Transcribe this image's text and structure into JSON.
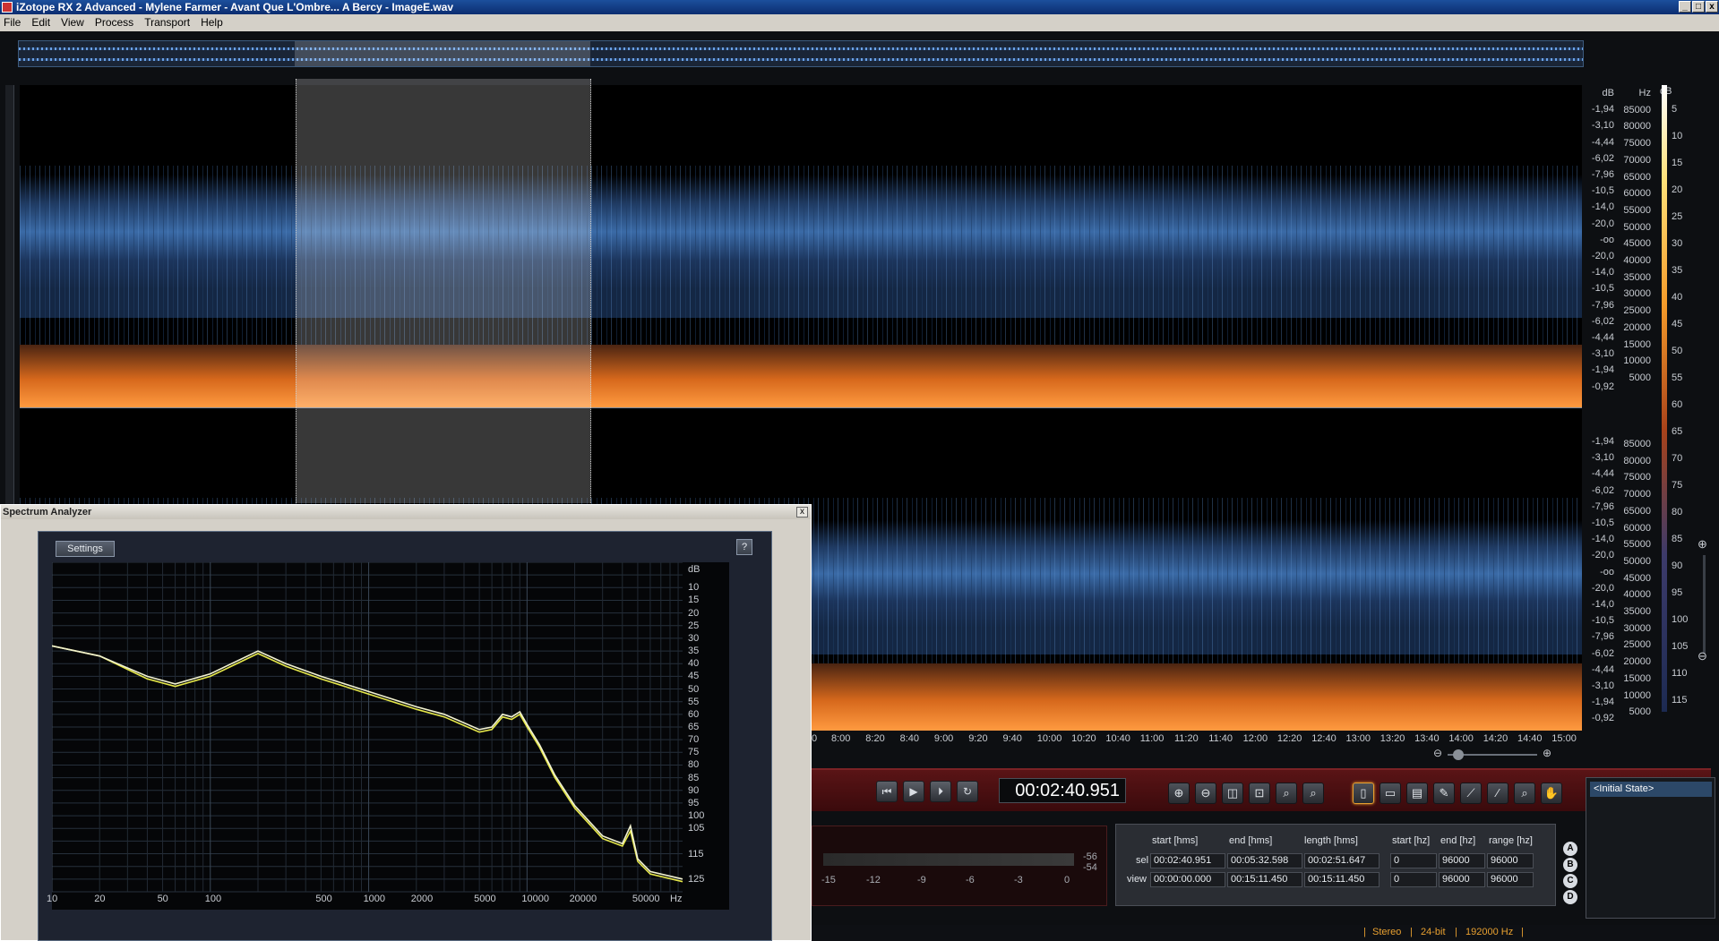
{
  "window": {
    "title": "iZotope RX 2 Advanced - Mylene Farmer - Avant Que L'Ombre... A Bercy - ImageE.wav"
  },
  "menu": [
    "File",
    "Edit",
    "View",
    "Process",
    "Transport",
    "Help"
  ],
  "spectrogram": {
    "db_scale_top": [
      "dB",
      "-1,94",
      "-3,10",
      "-4,44",
      "-6,02",
      "-7,96",
      "-10,5",
      "-14,0",
      "-20,0",
      "-oo",
      "-20,0",
      "-14,0",
      "-10,5",
      "-7,96",
      "-6,02",
      "-4,44",
      "-3,10",
      "-1,94",
      "-0,92"
    ],
    "db_scale_bottom": [
      "-1,94",
      "-3,10",
      "-4,44",
      "-6,02",
      "-7,96",
      "-10,5",
      "-14,0",
      "-20,0",
      "-oo",
      "-20,0",
      "-14,0",
      "-10,5",
      "-7,96",
      "-6,02",
      "-4,44",
      "-3,10",
      "-1,94",
      "-0,92"
    ],
    "hz_scale_top": [
      "Hz",
      "85000",
      "80000",
      "75000",
      "70000",
      "65000",
      "60000",
      "55000",
      "50000",
      "45000",
      "40000",
      "35000",
      "30000",
      "25000",
      "20000",
      "15000",
      "10000",
      "5000"
    ],
    "hz_scale_bottom": [
      "85000",
      "80000",
      "75000",
      "70000",
      "65000",
      "60000",
      "55000",
      "50000",
      "45000",
      "40000",
      "35000",
      "30000",
      "25000",
      "20000",
      "15000",
      "10000",
      "5000"
    ],
    "colorbar_label": "dB",
    "colorbar_ticks": [
      "5",
      "10",
      "15",
      "20",
      "25",
      "30",
      "35",
      "40",
      "45",
      "50",
      "55",
      "60",
      "65",
      "70",
      "75",
      "80",
      "85",
      "90",
      "95",
      "100",
      "105",
      "110",
      "115"
    ],
    "time_axis": [
      "0",
      "8:00",
      "8:20",
      "8:40",
      "9:00",
      "9:20",
      "9:40",
      "10:00",
      "10:20",
      "10:40",
      "11:00",
      "11:20",
      "11:40",
      "12:00",
      "12:20",
      "12:40",
      "13:00",
      "13:20",
      "13:40",
      "14:00",
      "14:20",
      "14:40",
      "15:00"
    ]
  },
  "transport": {
    "timecode": "00:02:40.951",
    "buttons": [
      "skip-back",
      "play",
      "play-selection",
      "loop"
    ],
    "tools": [
      "zoom-in",
      "zoom-out",
      "zoom-selection",
      "zoom-fit",
      "zoom-time",
      "zoom-freq",
      "time-select",
      "rect-select",
      "lasso-select",
      "freq-select",
      "magic-wand",
      "brush",
      "zoom-tool",
      "hand-tool"
    ]
  },
  "meter": {
    "scale": [
      "-15",
      "-12",
      "-9",
      "-6",
      "-3",
      "0"
    ],
    "peaks": [
      "-56",
      "-54"
    ]
  },
  "selection": {
    "headers": [
      "start [hms]",
      "end [hms]",
      "length [hms]",
      "start [hz]",
      "end [hz]",
      "range [hz]"
    ],
    "rows": [
      {
        "label": "sel",
        "values": [
          "00:02:40.951",
          "00:05:32.598",
          "00:02:51.647",
          "0",
          "96000",
          "96000"
        ]
      },
      {
        "label": "view",
        "values": [
          "00:00:00.000",
          "00:15:11.450",
          "00:15:11.450",
          "0",
          "96000",
          "96000"
        ]
      }
    ]
  },
  "abcd": [
    "A",
    "B",
    "C",
    "D"
  ],
  "history": {
    "items": [
      "<Initial State>"
    ]
  },
  "status": {
    "channels": "Stereo",
    "bitdepth": "24-bit",
    "samplerate": "192000 Hz"
  },
  "spectrum_analyzer": {
    "title": "Spectrum Analyzer",
    "settings_label": "Settings",
    "help_label": "?",
    "close_label": "x"
  },
  "chart_data": {
    "type": "line",
    "title": "",
    "xlabel": "Hz",
    "ylabel": "dB",
    "x_scale": "log",
    "xlim": [
      10,
      96000
    ],
    "ylim": [
      130,
      0
    ],
    "x_tick_labels": [
      "10",
      "20",
      "50",
      "100",
      "500",
      "1000",
      "2000",
      "5000",
      "10000",
      "20000",
      "50000",
      "Hz"
    ],
    "y_tick_labels": [
      "dB",
      "10",
      "15",
      "20",
      "25",
      "30",
      "35",
      "40",
      "45",
      "50",
      "55",
      "60",
      "65",
      "70",
      "75",
      "80",
      "85",
      "90",
      "95",
      "100",
      "105",
      "115",
      "125"
    ],
    "series": [
      {
        "color": "#e6e84a",
        "x": [
          10,
          20,
          40,
          60,
          100,
          200,
          300,
          500,
          1000,
          2000,
          3000,
          5000,
          6000,
          7000,
          8000,
          9000,
          10000,
          12000,
          15000,
          20000,
          30000,
          40000,
          45000,
          50000,
          60000,
          96000
        ],
        "y": [
          33,
          37,
          46,
          49,
          45,
          36,
          41,
          46,
          52,
          58,
          61,
          67,
          66,
          61,
          62,
          60,
          65,
          73,
          85,
          97,
          109,
          112,
          106,
          118,
          123,
          126
        ]
      },
      {
        "color": "#f2f2d0",
        "x": [
          10,
          20,
          40,
          60,
          100,
          200,
          300,
          500,
          1000,
          2000,
          3000,
          5000,
          6000,
          7000,
          8000,
          9000,
          10000,
          12000,
          15000,
          20000,
          30000,
          40000,
          45000,
          50000,
          60000,
          96000
        ],
        "y": [
          33,
          37,
          45,
          48,
          44,
          35,
          40,
          45,
          51,
          57,
          60,
          66,
          65,
          60,
          61,
          59,
          64,
          72,
          84,
          96,
          108,
          111,
          104,
          117,
          122,
          125
        ]
      }
    ],
    "grid": true
  }
}
